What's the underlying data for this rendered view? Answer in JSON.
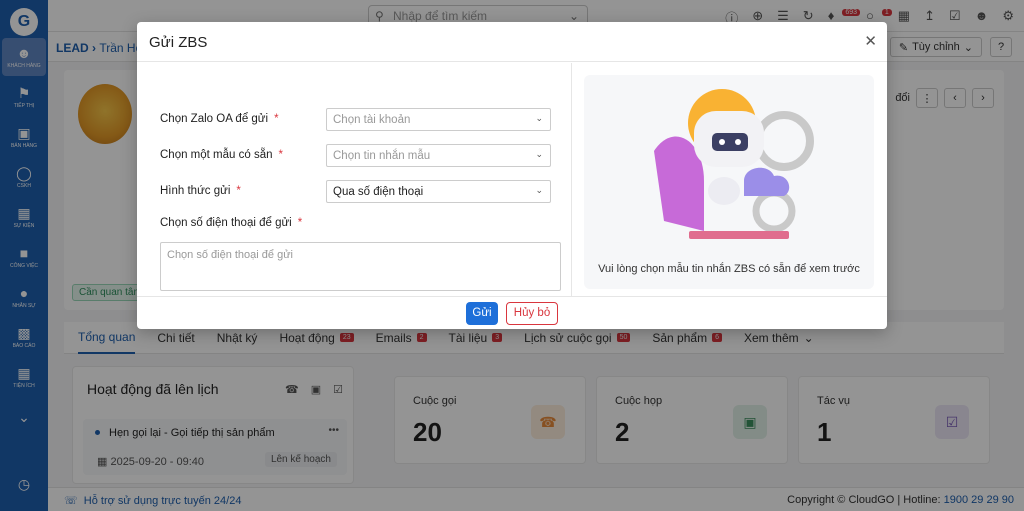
{
  "topbar": {
    "search_placeholder": "Nhập để tìm kiếm",
    "badge_notifications": "693",
    "badge_messages": "1"
  },
  "breadcrumb": {
    "module": "LEAD",
    "separator": "›",
    "record": "Trần Hoa"
  },
  "toolbar": {
    "customize_label": "Tùy chỉnh",
    "help_label": "?",
    "edit_label": "đổi"
  },
  "sidebar": {
    "logo": "G",
    "items": [
      {
        "label": "Khách hàng",
        "icon": "users-icon"
      },
      {
        "label": "Tiếp thị",
        "icon": "megaphone-icon"
      },
      {
        "label": "Bán hàng",
        "icon": "cart-icon"
      },
      {
        "label": "CSKH",
        "icon": "lifebuoy-icon"
      },
      {
        "label": "Sự kiện",
        "icon": "calendar-icon"
      },
      {
        "label": "Công việc",
        "icon": "briefcase-icon"
      },
      {
        "label": "Nhân sự",
        "icon": "person-icon"
      },
      {
        "label": "Báo cáo",
        "icon": "chart-icon"
      },
      {
        "label": "Tiện ích",
        "icon": "apps-icon"
      }
    ]
  },
  "profile": {
    "tag_label": "Cần quan tâm"
  },
  "tabs": [
    {
      "label": "Tổng quan",
      "count": null
    },
    {
      "label": "Chi tiết",
      "count": null
    },
    {
      "label": "Nhật ký",
      "count": null
    },
    {
      "label": "Hoạt động",
      "count": "23"
    },
    {
      "label": "Emails",
      "count": "2"
    },
    {
      "label": "Tài liệu",
      "count": "3"
    },
    {
      "label": "Lịch sử cuộc gọi",
      "count": "50"
    },
    {
      "label": "Sản phẩm",
      "count": "6"
    },
    {
      "label": "Xem thêm",
      "count": null
    }
  ],
  "activity": {
    "title": "Hoạt động đã lên lịch",
    "item_title": "Hẹn gọi lại - Gọi tiếp thị sản phẩm",
    "item_more": "•••",
    "item_date": "2025-09-20 - 09:40",
    "item_plan": "Lên kế hoạch"
  },
  "stats": [
    {
      "name": "Cuộc gọi",
      "value": "20",
      "bg": "#fdeedd",
      "fg": "#e88a3a"
    },
    {
      "name": "Cuộc họp",
      "value": "2",
      "bg": "#e2f2e8",
      "fg": "#3d8f5f"
    },
    {
      "name": "Tác vụ",
      "value": "1",
      "bg": "#ece7f7",
      "fg": "#7b5db8"
    }
  ],
  "footer": {
    "support": "Hỗ trợ sử dụng trực tuyến 24/24",
    "copyright": "Copyright © CloudGO | Hotline:",
    "hotline": "1900 29 29 90"
  },
  "modal": {
    "title": "Gửi ZBS",
    "close": "✕",
    "fields": {
      "oa_label": "Chọn Zalo OA để gửi",
      "oa_placeholder": "Chọn tài khoản",
      "template_label": "Chọn một mẫu có sẵn",
      "template_placeholder": "Chọn tin nhắn mẫu",
      "method_label": "Hình thức gửi",
      "method_value": "Qua số điện thoại",
      "phone_label": "Chọn số điện thoại để gửi",
      "phone_placeholder": "Chọn số điện thoại để gửi"
    },
    "required_mark": "*",
    "preview_text": "Vui lòng chọn mẫu tin nhắn ZBS có sẵn để xem trước",
    "send_label": "Gửi",
    "cancel_label": "Hủy bỏ"
  },
  "colors": {
    "primary": "#1e5fae",
    "danger": "#d9363e"
  }
}
